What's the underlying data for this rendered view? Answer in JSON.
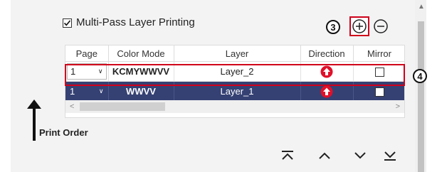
{
  "multipass": {
    "label": "Multi-Pass Layer Printing",
    "checked": true
  },
  "callouts": {
    "add_number": "3",
    "row_number": "4"
  },
  "table": {
    "headers": [
      "Page",
      "Color Mode",
      "Layer",
      "Direction",
      "Mirror"
    ],
    "rows": [
      {
        "page": "1",
        "color_mode": "KCMYWWVV",
        "layer": "Layer_2",
        "direction": "up",
        "mirror": false,
        "selected": false
      },
      {
        "page": "1",
        "color_mode": "WWVV",
        "layer": "Layer_1",
        "direction": "up",
        "mirror": false,
        "selected": true
      }
    ]
  },
  "print_order_label": "Print Order",
  "colors": {
    "accent_red": "#d0001b",
    "selected_row": "#354173",
    "direction_red": "#e0102a"
  }
}
